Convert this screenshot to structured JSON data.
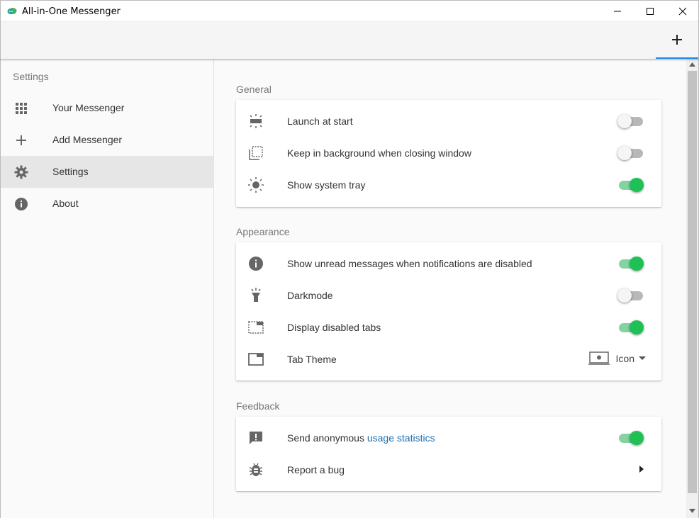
{
  "window": {
    "title": "All-in-One Messenger",
    "minimize_icon": "minimize-icon",
    "maximize_icon": "maximize-icon",
    "close_icon": "close-icon"
  },
  "tabbar": {
    "add_tab_icon": "plus-icon",
    "accent_color": "#1e88e5"
  },
  "sidebar": {
    "header": "Settings",
    "items": [
      {
        "label": "Your Messenger",
        "icon": "apps-grid-icon",
        "active": false
      },
      {
        "label": "Add Messenger",
        "icon": "plus-icon",
        "active": false
      },
      {
        "label": "Settings",
        "icon": "gear-icon",
        "active": true
      },
      {
        "label": "About",
        "icon": "info-icon",
        "active": false
      }
    ]
  },
  "sections": [
    {
      "title": "General",
      "rows": [
        {
          "label": "Launch at start",
          "icon": "launch-icon",
          "control": "toggle",
          "value": false
        },
        {
          "label": "Keep in background when closing window",
          "icon": "background-window-icon",
          "control": "toggle",
          "value": false
        },
        {
          "label": "Show system tray",
          "icon": "brightness-icon",
          "control": "toggle",
          "value": true
        }
      ]
    },
    {
      "title": "Appearance",
      "rows": [
        {
          "label": "Show unread messages when notifications are disabled",
          "icon": "info-icon",
          "control": "toggle",
          "value": true
        },
        {
          "label": "Darkmode",
          "icon": "flashlight-icon",
          "control": "toggle",
          "value": false
        },
        {
          "label": "Display disabled tabs",
          "icon": "tab-dashed-icon",
          "control": "toggle",
          "value": true
        },
        {
          "label": "Tab Theme",
          "icon": "tab-icon",
          "control": "select",
          "selected": "Icon",
          "selected_icon": "tab-theme-icon"
        }
      ]
    },
    {
      "title": "Feedback",
      "rows": [
        {
          "label_prefix": "Send anonymous ",
          "label_link": "usage statistics",
          "icon": "feedback-icon",
          "control": "toggle",
          "value": true
        },
        {
          "label": "Report a bug",
          "icon": "bug-icon",
          "control": "arrow"
        }
      ]
    }
  ],
  "colors": {
    "toggle_on": "#1fc157",
    "toggle_on_track": "#85d3a3",
    "toggle_off_track": "#b8b8b8",
    "link": "#1e6fb0"
  }
}
